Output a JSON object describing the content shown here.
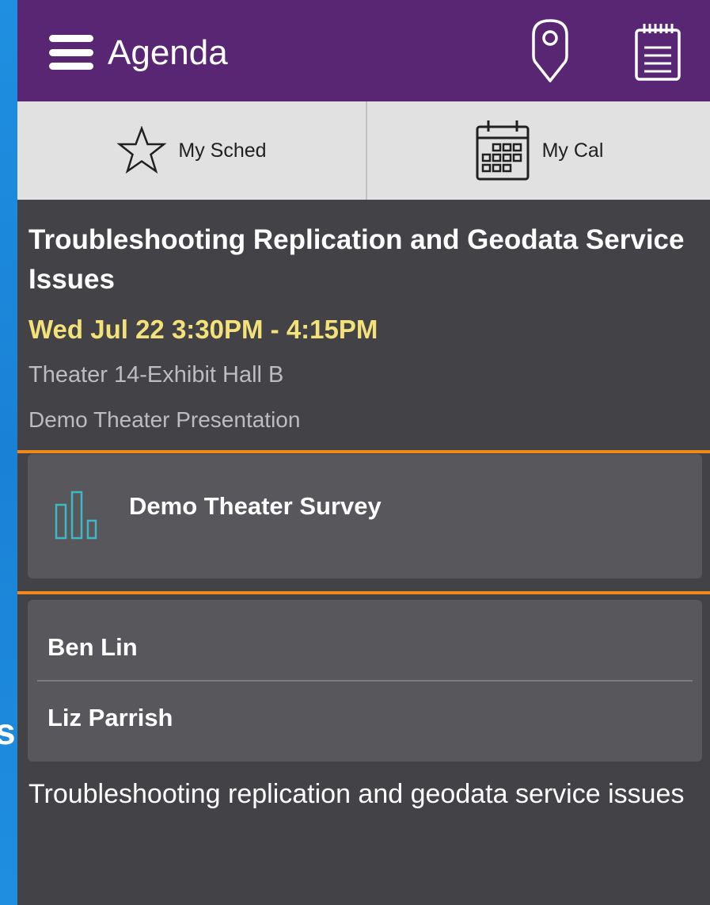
{
  "header": {
    "title": "Agenda",
    "menu_icon": "hamburger-menu-icon",
    "map_icon": "map-pin-icon",
    "notes_icon": "notepad-icon"
  },
  "tabs": [
    {
      "label": "My Sched",
      "icon": "star-icon"
    },
    {
      "label": "My Cal",
      "icon": "calendar-icon"
    }
  ],
  "session": {
    "title": "Troubleshooting Replication and Geodata Service Issues",
    "time": "Wed Jul 22 3:30PM - 4:15PM",
    "room": "Theater 14-Exhibit Hall B",
    "type": "Demo Theater Presentation",
    "description": "Troubleshooting replication and geodata service issues"
  },
  "survey": {
    "label": "Demo Theater Survey",
    "icon": "bar-chart-icon"
  },
  "speakers": [
    {
      "name": "Ben Lin"
    },
    {
      "name": "Liz Parrish"
    }
  ],
  "background_edge_text": "s",
  "colors": {
    "header_bg": "#582673",
    "tab_bg": "#e1e1e1",
    "content_bg": "#434246",
    "card_bg": "#58575b",
    "accent_orange": "#f0881d",
    "time_yellow": "#f3e27a",
    "survey_teal": "#3fb8c4",
    "outer_blue": "#1f8fe0"
  }
}
